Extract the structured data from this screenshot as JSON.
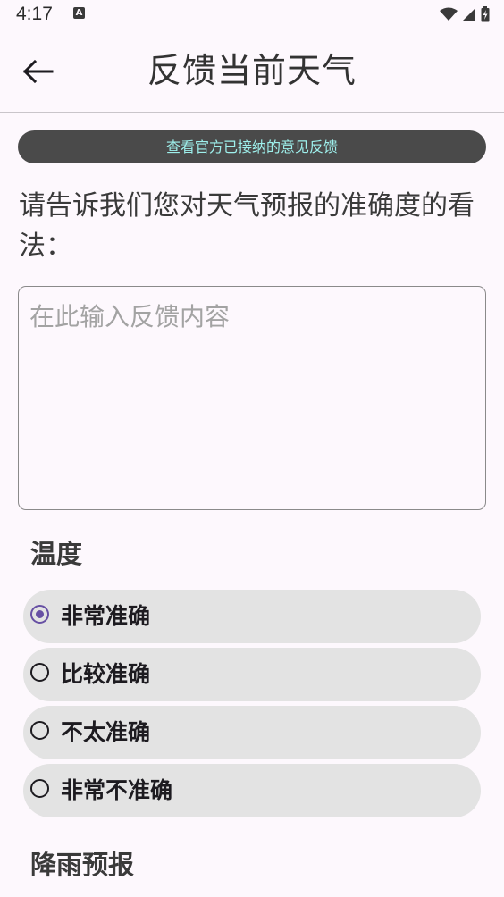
{
  "status_bar": {
    "time": "4:17",
    "notification_glyph": "A",
    "icons": [
      "wifi-icon",
      "signal-icon",
      "battery-icon"
    ]
  },
  "app_bar": {
    "title": "反馈当前天气",
    "back_icon": "arrow-left-icon"
  },
  "official_feedback_button": "查看官方已接纳的意见反馈",
  "prompt": "请告诉我们您对天气预报的准确度的看法：",
  "feedback_input": {
    "value": "",
    "placeholder": "在此输入反馈内容"
  },
  "sections": [
    {
      "title": "温度",
      "options": [
        {
          "label": "非常准确",
          "selected": true
        },
        {
          "label": "比较准确",
          "selected": false
        },
        {
          "label": "不太准确",
          "selected": false
        },
        {
          "label": "非常不准确",
          "selected": false
        }
      ]
    },
    {
      "title": "降雨预报"
    }
  ],
  "colors": {
    "background": "#fdf8fd",
    "accent": "#6750a4",
    "button_bg": "#4a4a4a",
    "button_text": "#9ef0ec",
    "option_bg": "#e3e3e3"
  }
}
